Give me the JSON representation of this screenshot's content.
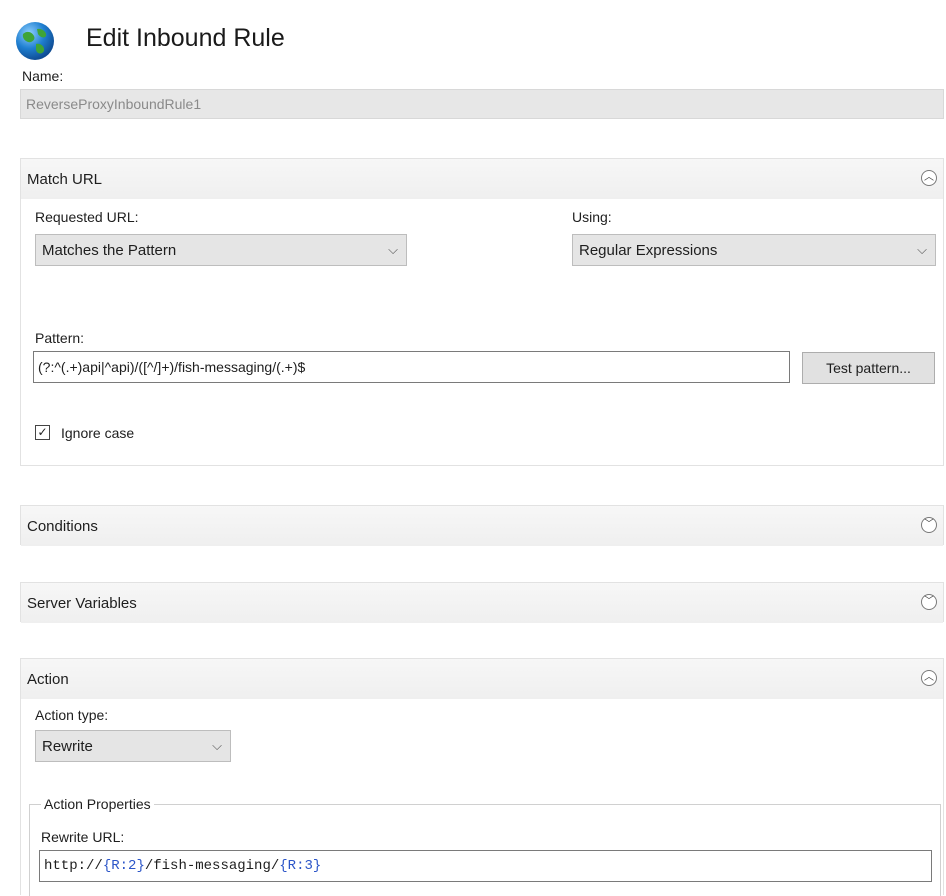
{
  "header": {
    "title": "Edit Inbound Rule",
    "icon": "globe-icon"
  },
  "name": {
    "label": "Name:",
    "value": "ReverseProxyInboundRule1"
  },
  "match_url": {
    "section_title": "Match URL",
    "requested_url": {
      "label": "Requested URL:",
      "value": "Matches the Pattern"
    },
    "using": {
      "label": "Using:",
      "value": "Regular Expressions"
    },
    "pattern": {
      "label": "Pattern:",
      "value": "(?:^(.+)api|^api)/([^/]+)/fish-messaging/(.+)$"
    },
    "test_pattern_label": "Test pattern...",
    "ignore_case": {
      "label": "Ignore case",
      "checked": true
    }
  },
  "conditions": {
    "section_title": "Conditions"
  },
  "server_variables": {
    "section_title": "Server Variables"
  },
  "action": {
    "section_title": "Action",
    "action_type": {
      "label": "Action type:",
      "value": "Rewrite"
    },
    "properties": {
      "group_title": "Action Properties",
      "rewrite_url_label": "Rewrite URL:",
      "rewrite_url_parts": {
        "p1": "http://",
        "b1": "{",
        "r1": "R:2",
        "b2": "}",
        "p2": "/fish-messaging/",
        "b3": "{",
        "r2": "R:3",
        "b4": "}"
      }
    }
  },
  "colors": {
    "accent_blue": "#2b55c8",
    "panel_header": "#efefef"
  }
}
